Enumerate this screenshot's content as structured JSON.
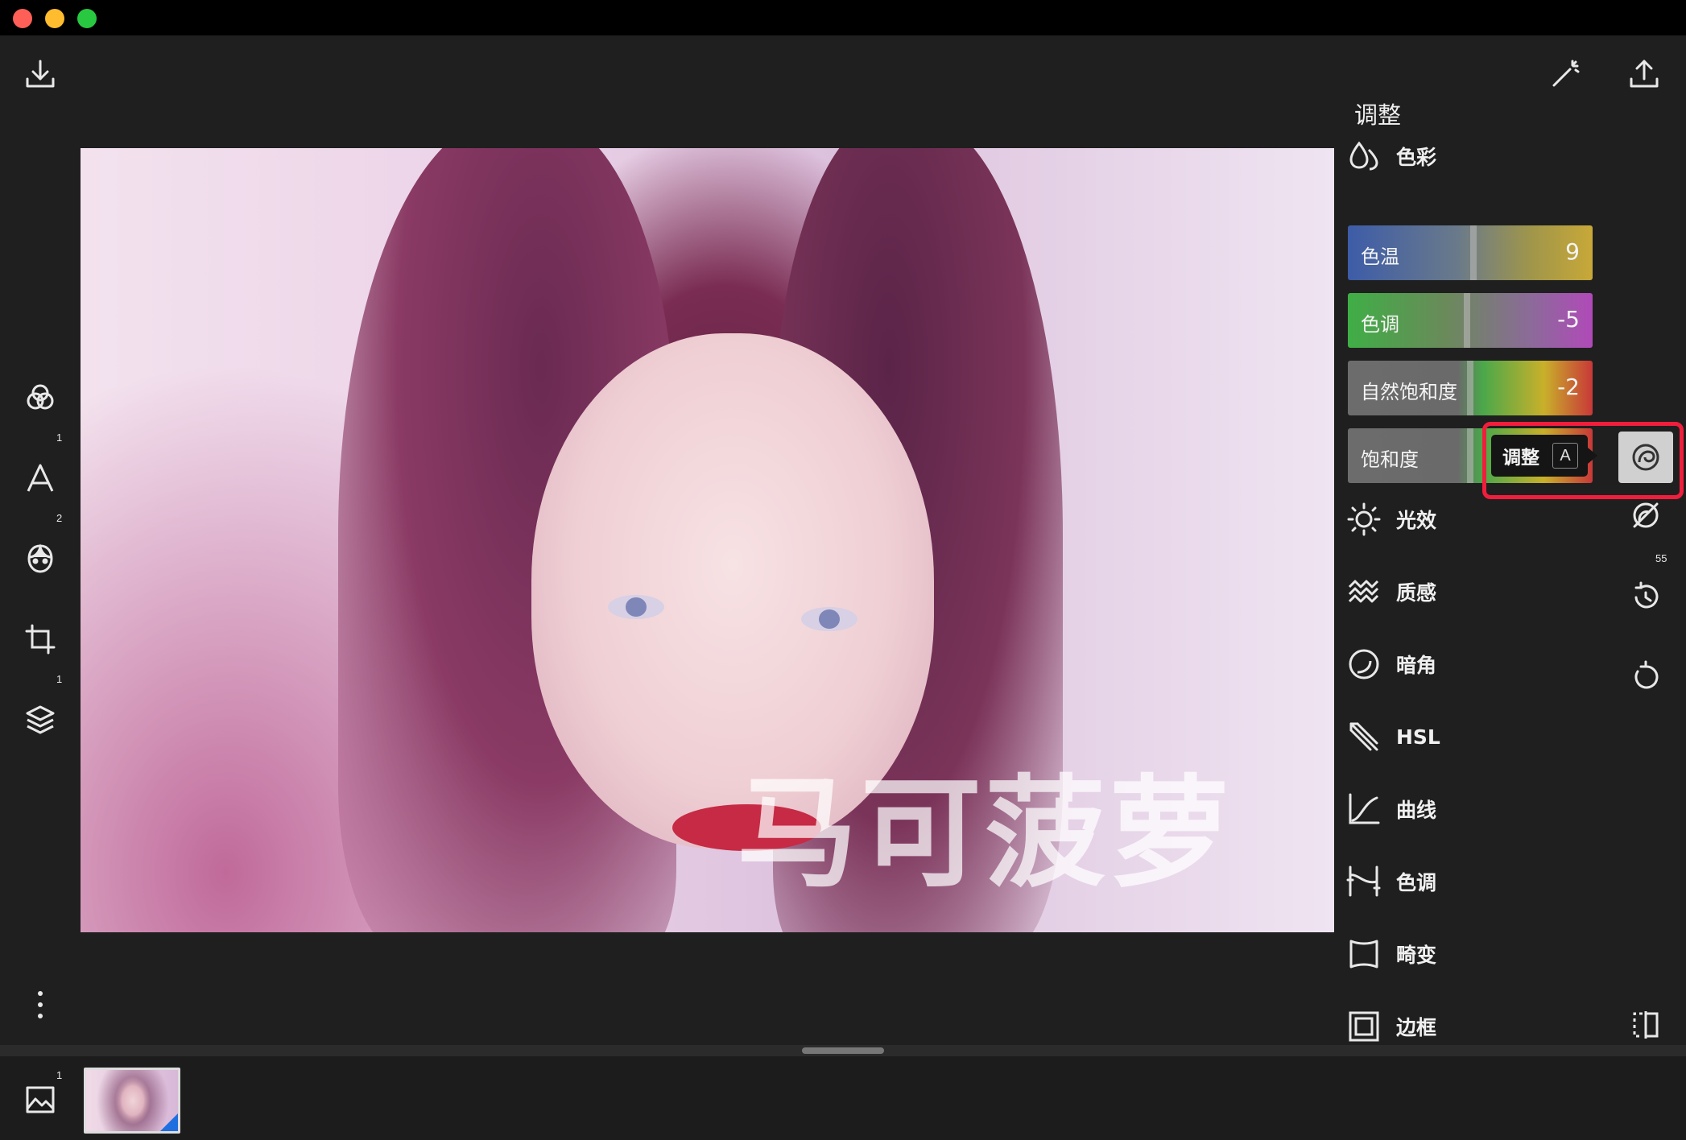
{
  "window": {
    "close": "close",
    "minimize": "minimize",
    "maximize": "maximize"
  },
  "left_toolbar": {
    "text_badge": "1",
    "face_badge": "2",
    "layers_badge": "1"
  },
  "photo": {
    "watermark": "马可菠萝"
  },
  "panel": {
    "title": "调整",
    "color_section": "色彩",
    "sliders": [
      {
        "label": "色温",
        "value": "9"
      },
      {
        "label": "色调",
        "value": "-5"
      },
      {
        "label": "自然饱和度",
        "value": "-2"
      },
      {
        "label": "饱和度"
      }
    ],
    "tooltip": {
      "label": "调整",
      "shortcut": "A"
    },
    "sections": [
      {
        "label": "光效",
        "icon": "sun-icon"
      },
      {
        "label": "质感",
        "icon": "waves-icon"
      },
      {
        "label": "暗角",
        "icon": "vignette-icon"
      },
      {
        "label": "HSL",
        "icon": "brush-icon"
      },
      {
        "label": "曲线",
        "icon": "curve-icon"
      },
      {
        "label": "色调",
        "icon": "tone-icon"
      },
      {
        "label": "畸变",
        "icon": "distortion-icon"
      },
      {
        "label": "边框",
        "icon": "frame-icon"
      }
    ]
  },
  "right_toolbar": {
    "history_badge": "55"
  },
  "filmstrip": {
    "images_badge": "1"
  },
  "colors": {
    "highlight": "#f01e3c",
    "background": "#1f1f1f",
    "selection": "#1f6fe0"
  }
}
